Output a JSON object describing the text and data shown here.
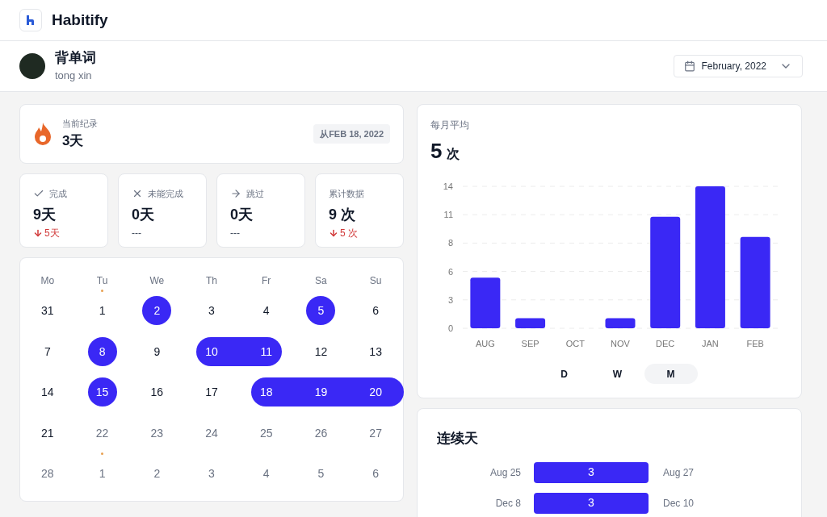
{
  "app": {
    "name": "Habitify"
  },
  "habit": {
    "title": "背单词",
    "user": "tong xin"
  },
  "month_picker": {
    "label": "February, 2022"
  },
  "current_streak": {
    "label": "当前纪录",
    "value": "3天",
    "since": "从FEB 18, 2022"
  },
  "stats": [
    {
      "kind": "completed",
      "label": "完成",
      "value": "9天",
      "change": "5天",
      "down": true
    },
    {
      "kind": "failed",
      "label": "未能完成",
      "value": "0天",
      "change": "---",
      "down": false
    },
    {
      "kind": "skipped",
      "label": "跳过",
      "value": "0天",
      "change": "---",
      "down": false
    },
    {
      "kind": "total",
      "label": "累计数据",
      "value": "9 次",
      "change": "5 次",
      "down": true
    }
  ],
  "calendar": {
    "weekdays": [
      "Mo",
      "Tu",
      "We",
      "Th",
      "Fr",
      "Sa",
      "Su"
    ],
    "weeks": [
      [
        {
          "label": "31",
          "done": false,
          "muted": false,
          "dot": false
        },
        {
          "label": "1",
          "done": false,
          "muted": false,
          "dot": true
        },
        {
          "label": "2",
          "done": true,
          "muted": false,
          "dot": false
        },
        {
          "label": "3",
          "done": false,
          "muted": false,
          "dot": false
        },
        {
          "label": "4",
          "done": false,
          "muted": false,
          "dot": false
        },
        {
          "label": "5",
          "done": true,
          "muted": false,
          "dot": false
        },
        {
          "label": "6",
          "done": false,
          "muted": false,
          "dot": false
        }
      ],
      [
        {
          "label": "7",
          "done": false,
          "muted": false,
          "dot": false
        },
        {
          "label": "8",
          "done": true,
          "muted": false,
          "dot": false
        },
        {
          "label": "9",
          "done": false,
          "muted": false,
          "dot": false
        },
        {
          "label": "10",
          "done": true,
          "muted": false,
          "dot": false
        },
        {
          "label": "11",
          "done": true,
          "muted": false,
          "dot": false
        },
        {
          "label": "12",
          "done": false,
          "muted": false,
          "dot": false
        },
        {
          "label": "13",
          "done": false,
          "muted": false,
          "dot": false
        }
      ],
      [
        {
          "label": "14",
          "done": false,
          "muted": false,
          "dot": false
        },
        {
          "label": "15",
          "done": true,
          "muted": false,
          "dot": false
        },
        {
          "label": "16",
          "done": false,
          "muted": false,
          "dot": false
        },
        {
          "label": "17",
          "done": false,
          "muted": false,
          "dot": false
        },
        {
          "label": "18",
          "done": true,
          "muted": false,
          "dot": false
        },
        {
          "label": "19",
          "done": true,
          "muted": false,
          "dot": false
        },
        {
          "label": "20",
          "done": true,
          "muted": false,
          "dot": false
        }
      ],
      [
        {
          "label": "21",
          "done": false,
          "muted": false,
          "dot": false
        },
        {
          "label": "22",
          "done": false,
          "muted": true,
          "dot": false
        },
        {
          "label": "23",
          "done": false,
          "muted": true,
          "dot": false
        },
        {
          "label": "24",
          "done": false,
          "muted": true,
          "dot": false
        },
        {
          "label": "25",
          "done": false,
          "muted": true,
          "dot": false
        },
        {
          "label": "26",
          "done": false,
          "muted": true,
          "dot": false
        },
        {
          "label": "27",
          "done": false,
          "muted": true,
          "dot": false
        }
      ],
      [
        {
          "label": "28",
          "done": false,
          "muted": true,
          "dot": false
        },
        {
          "label": "1",
          "done": false,
          "muted": true,
          "dot": true
        },
        {
          "label": "2",
          "done": false,
          "muted": true,
          "dot": false
        },
        {
          "label": "3",
          "done": false,
          "muted": true,
          "dot": false
        },
        {
          "label": "4",
          "done": false,
          "muted": true,
          "dot": false
        },
        {
          "label": "5",
          "done": false,
          "muted": true,
          "dot": false
        },
        {
          "label": "6",
          "done": false,
          "muted": true,
          "dot": false
        }
      ]
    ]
  },
  "monthly_average": {
    "label": "每月平均",
    "value": "5",
    "unit": "次",
    "chart_data": {
      "type": "bar",
      "categories": [
        "AUG",
        "SEP",
        "OCT",
        "NOV",
        "DEC",
        "JAN",
        "FEB"
      ],
      "series": [
        {
          "color": "#3a28f5",
          "values": [
            5,
            1,
            0,
            1,
            11,
            14,
            9
          ]
        }
      ],
      "grid": true,
      "ylim": [
        0,
        14
      ],
      "yticks": [
        {
          "value": 0,
          "label": "0"
        },
        {
          "value": 2.8,
          "label": "3"
        },
        {
          "value": 5.6,
          "label": "6"
        },
        {
          "value": 8.4,
          "label": "8"
        },
        {
          "value": 11.2,
          "label": "11"
        },
        {
          "value": 14,
          "label": "14"
        }
      ]
    }
  },
  "period_tabs": [
    {
      "label": "D",
      "selected": false
    },
    {
      "label": "W",
      "selected": false
    },
    {
      "label": "M",
      "selected": true
    }
  ],
  "streaks": {
    "title": "连续天",
    "rows": [
      {
        "start": "Aug 25",
        "length": "3",
        "end": "Aug 27"
      },
      {
        "start": "Dec 8",
        "length": "3",
        "end": "Dec 10"
      }
    ]
  }
}
